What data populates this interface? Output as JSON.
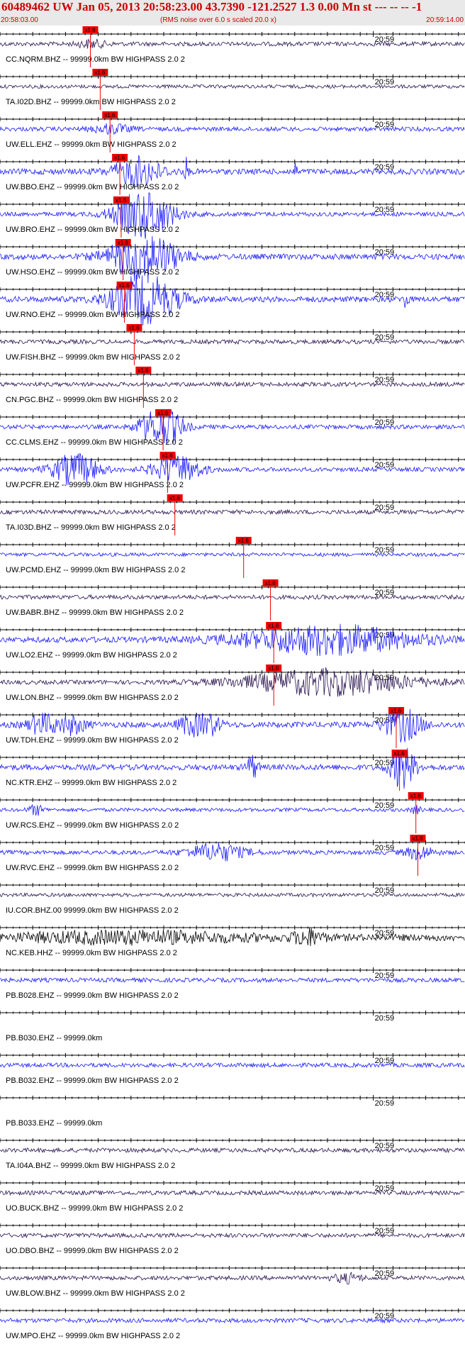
{
  "header": {
    "title": "60489462 UW Jan 05, 2013 20:58:23.00   43.7390 -121.2527  1.3 0.00 Mn st --- -- --   -1",
    "start_time": "20:58:03.00",
    "end_time": "20:59:14.00",
    "rms_note": "(RMS noise over 6.0 s scaled 20.0 x)"
  },
  "chart_data": {
    "type": "line",
    "title": "60489462 UW Jan 05, 2013 20:58:23.00   43.7390 -121.2527  1.3 0.00 Mn st --- -- --   -1",
    "x_range": [
      "20:58:03.00",
      "20:59:14.00"
    ],
    "minute_mark_label": "20:59",
    "phase_marker_label": "x1.6",
    "colors": {
      "blue": "#1a1aff",
      "dark": "#2a1450",
      "black": "#000000",
      "marker": "#ee0000"
    },
    "traces": [
      {
        "label": "CC.NQRM.BHZ -- 99999.0km BW  HIGHPASS  2.0  2",
        "color": "dark",
        "amp": 3,
        "pick_s": 13.8,
        "bursts": [
          {
            "t": 14,
            "a": 5,
            "w": 1.5
          }
        ]
      },
      {
        "label": "TA.I02D.BHZ -- 99999.0km BW  HIGHPASS  2.0  2",
        "color": "dark",
        "amp": 2.5,
        "pick_s": 15.3,
        "bursts": []
      },
      {
        "label": "UW.ELL.EHZ -- 99999.0km BW  HIGHPASS  2.0  2",
        "color": "blue",
        "amp": 3,
        "pick_s": 16.8,
        "bursts": [
          {
            "t": 17,
            "a": 6,
            "w": 2
          }
        ]
      },
      {
        "label": "UW.BBO.EHZ -- 99999.0km BW  HIGHPASS  2.0  2",
        "color": "blue",
        "amp": 4,
        "pick_s": 18.3,
        "bursts": [
          {
            "t": 21,
            "a": 20,
            "w": 2.5
          },
          {
            "t": 28.5,
            "a": 18,
            "w": 0.2
          },
          {
            "t": 45,
            "a": 14,
            "w": 0.2
          }
        ]
      },
      {
        "label": "UW.BRO.EHZ -- 99999.0km BW  HIGHPASS  2.0  2",
        "color": "blue",
        "amp": 3,
        "pick_s": 18.5,
        "bursts": [
          {
            "t": 22,
            "a": 34,
            "w": 3
          }
        ]
      },
      {
        "label": "UW.HSO.EHZ -- 99999.0km BW  HIGHPASS  2.0  2",
        "color": "blue",
        "amp": 4,
        "pick_s": 18.8,
        "bursts": [
          {
            "t": 22,
            "a": 34,
            "w": 3.5
          },
          {
            "t": 73.5,
            "a": 18,
            "w": 0.2
          }
        ]
      },
      {
        "label": "UW.RNO.EHZ -- 99999.0km BW  HIGHPASS  2.0  2",
        "color": "blue",
        "amp": 4,
        "pick_s": 19.0,
        "bursts": [
          {
            "t": 22,
            "a": 34,
            "w": 3.5
          },
          {
            "t": 62,
            "a": 12,
            "w": 0.3
          }
        ]
      },
      {
        "label": "UW.FISH.BHZ -- 99999.0km BW  HIGHPASS  2.0  2",
        "color": "dark",
        "amp": 3,
        "pick_s": 20.5,
        "bursts": []
      },
      {
        "label": "CN.PGC.BHZ -- 99999.0km BW  HIGHPASS  2.0  2",
        "color": "dark",
        "amp": 3,
        "pick_s": 21.9,
        "bursts": []
      },
      {
        "label": "CC.CLMS.EHZ -- 99999.0km BW  HIGHPASS  2.0  2",
        "color": "blue",
        "amp": 3,
        "pick_s": 24.9,
        "bursts": [
          {
            "t": 25.5,
            "a": 24,
            "w": 1.8
          },
          {
            "t": 22.5,
            "a": 12,
            "w": 1.5
          }
        ]
      },
      {
        "label": "UW.PCFR.EHZ -- 99999.0km BW  HIGHPASS  2.0  2",
        "color": "blue",
        "amp": 3,
        "pick_s": 25.6,
        "bursts": [
          {
            "t": 11.5,
            "a": 22,
            "w": 2.5
          },
          {
            "t": 27,
            "a": 20,
            "w": 2.5
          }
        ]
      },
      {
        "label": "TA.I03D.BHZ -- 99999.0km BW  HIGHPASS  2.0  2",
        "color": "dark",
        "amp": 3,
        "pick_s": 26.7,
        "bursts": []
      },
      {
        "label": "UW.PCMD.EHZ -- 99999.0km BW  HIGHPASS  2.0  2",
        "color": "blue",
        "amp": 2.5,
        "pick_s": 37.2,
        "bursts": []
      },
      {
        "label": "UW.BABR.BHZ -- 99999.0km BW  HIGHPASS  2.0  2",
        "color": "dark",
        "amp": 3,
        "pick_s": 41.3,
        "bursts": []
      },
      {
        "label": "UW.LO2.EHZ -- 99999.0km BW  HIGHPASS  2.0  2",
        "color": "blue",
        "amp": 4,
        "pick_s": 41.8,
        "bursts": [
          {
            "t": 50,
            "a": 20,
            "w": 9
          }
        ]
      },
      {
        "label": "UW.LON.BHZ -- 99999.0km BW  HIGHPASS  2.0  2",
        "color": "dark",
        "amp": 3,
        "pick_s": 41.8,
        "bursts": [
          {
            "t": 50,
            "a": 18,
            "w": 9
          }
        ]
      },
      {
        "label": "UW.TDH.EHZ -- 99999.0km BW  HIGHPASS  2.0  2",
        "color": "blue",
        "amp": 4,
        "pick_s": 60.5,
        "bursts": [
          {
            "t": 6.5,
            "a": 14,
            "w": 1.5
          },
          {
            "t": 11,
            "a": 12,
            "w": 1.5
          },
          {
            "t": 29,
            "a": 14,
            "w": 1.2
          },
          {
            "t": 32,
            "a": 14,
            "w": 1.2
          },
          {
            "t": 61.5,
            "a": 22,
            "w": 2
          }
        ]
      },
      {
        "label": "NC.KTR.EHZ -- 99999.0km BW  HIGHPASS  2.0  2",
        "color": "blue",
        "amp": 4,
        "pick_s": 61.0,
        "bursts": [
          {
            "t": 38.5,
            "a": 16,
            "w": 0.6
          },
          {
            "t": 61.5,
            "a": 30,
            "w": 1.3
          }
        ]
      },
      {
        "label": "UW.RCS.EHZ -- 99999.0km BW  HIGHPASS  2.0  2",
        "color": "blue",
        "amp": 2.5,
        "pick_s": 63.5,
        "bursts": [
          {
            "t": 5.5,
            "a": 7,
            "w": 0.8
          },
          {
            "t": 63.5,
            "a": 5,
            "w": 0.5
          }
        ]
      },
      {
        "label": "UW.RVC.EHZ -- 99999.0km BW  HIGHPASS  2.0  2",
        "color": "blue",
        "amp": 3,
        "pick_s": 63.8,
        "bursts": [
          {
            "t": 33,
            "a": 12,
            "w": 3
          },
          {
            "t": 64,
            "a": 9,
            "w": 1.5
          }
        ]
      },
      {
        "label": "IU.COR.BHZ.00 99999.0km BW  HIGHPASS  2.0  2",
        "color": "dark",
        "amp": 2.5,
        "pick_s": null,
        "bursts": []
      },
      {
        "label": "NC.KEB.HHZ -- 99999.0km BW  HIGHPASS  2.0  2",
        "color": "black",
        "amp": 5,
        "pick_s": null,
        "bursts": [
          {
            "t": 47,
            "a": 10,
            "w": 1.5
          },
          {
            "t": 20,
            "a": 7,
            "w": 12
          }
        ]
      },
      {
        "label": "PB.B028.EHZ -- 99999.0km BW  HIGHPASS  2.0  2",
        "color": "blue",
        "amp": 3,
        "pick_s": null,
        "bursts": []
      },
      {
        "label": "PB.B030.EHZ -- 99999.0km",
        "color": "blue",
        "amp": 0,
        "pick_s": null,
        "bursts": []
      },
      {
        "label": "PB.B032.EHZ -- 99999.0km BW  HIGHPASS  2.0  2",
        "color": "blue",
        "amp": 3,
        "pick_s": null,
        "bursts": []
      },
      {
        "label": "PB.B033.EHZ -- 99999.0km",
        "color": "blue",
        "amp": 0,
        "pick_s": null,
        "bursts": []
      },
      {
        "label": "TA.I04A.BHZ -- 99999.0km BW  HIGHPASS  2.0  2",
        "color": "dark",
        "amp": 3,
        "pick_s": null,
        "bursts": []
      },
      {
        "label": "UO.BUCK.BHZ -- 99999.0km BW  HIGHPASS  2.0  2",
        "color": "dark",
        "amp": 3,
        "pick_s": null,
        "bursts": []
      },
      {
        "label": "UO.DBO.BHZ -- 99999.0km BW  HIGHPASS  2.0  2",
        "color": "dark",
        "amp": 3,
        "pick_s": null,
        "bursts": []
      },
      {
        "label": "UW.BLOW.BHZ -- 99999.0km BW  HIGHPASS  2.0  2",
        "color": "dark",
        "amp": 3,
        "pick_s": null,
        "bursts": [
          {
            "t": 53,
            "a": 6,
            "w": 1.5
          }
        ]
      },
      {
        "label": "UW.MPO.EHZ -- 99999.0km BW  HIGHPASS  2.0  2",
        "color": "blue",
        "amp": 3,
        "pick_s": null,
        "bursts": []
      }
    ]
  }
}
